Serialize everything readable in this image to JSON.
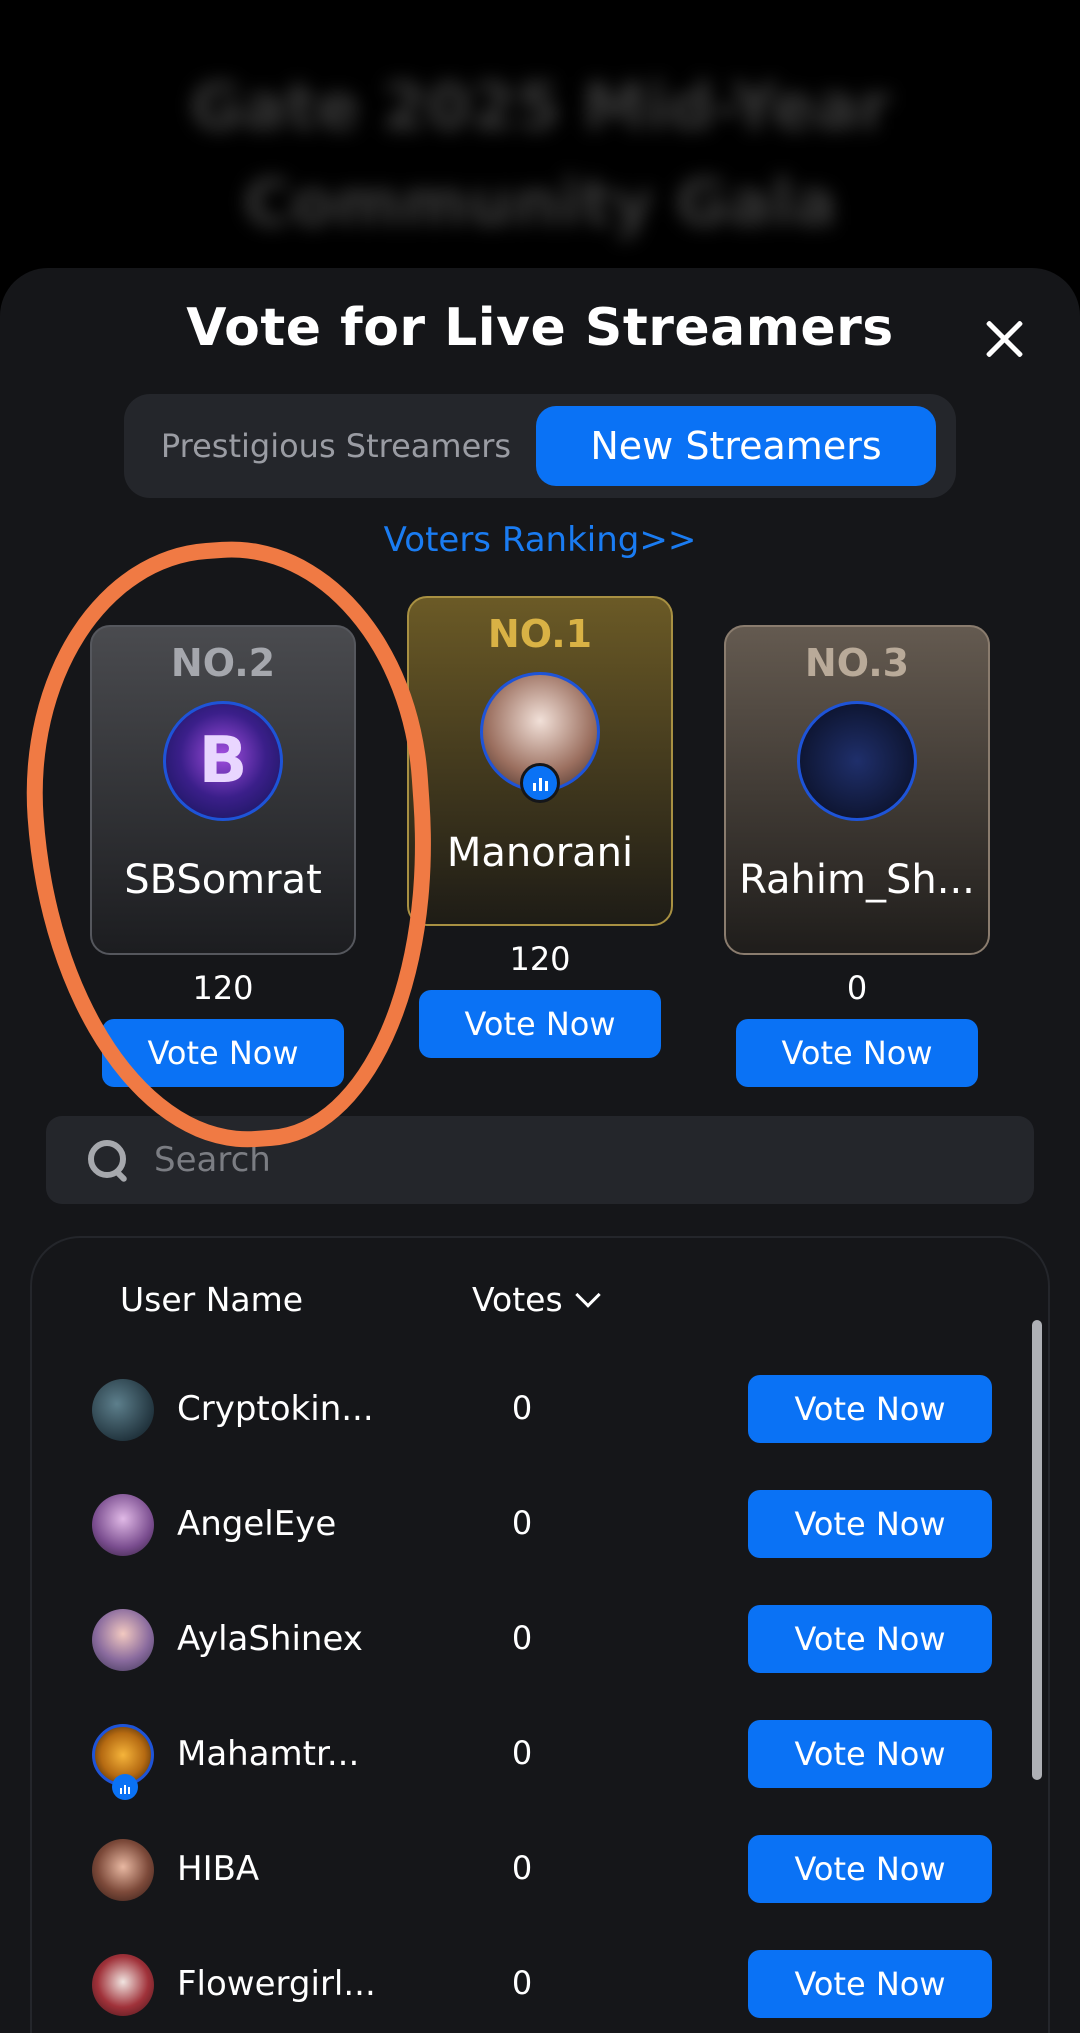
{
  "background": {
    "title": "Gate 2025 Mid-Year Community Gala"
  },
  "sheet": {
    "title": "Vote for Live Streamers",
    "tabs": [
      {
        "label": "Prestigious Streamers",
        "active": false
      },
      {
        "label": "New Streamers",
        "active": true
      }
    ],
    "voters_ranking": "Voters Ranking>>"
  },
  "podium": [
    {
      "rank": "NO.2",
      "name": "SBSomrat",
      "votes": "120",
      "button": "Vote Now",
      "avatar_text": "B"
    },
    {
      "rank": "NO.1",
      "name": "Manorani",
      "votes": "120",
      "button": "Vote Now",
      "live": true
    },
    {
      "rank": "NO.3",
      "name": "Rahim_Sh...",
      "votes": "0",
      "button": "Vote Now"
    }
  ],
  "search": {
    "placeholder": "Search"
  },
  "table": {
    "header_name": "User Name",
    "header_votes": "Votes",
    "rows": [
      {
        "name": "Cryptokin...",
        "votes": "0",
        "button": "Vote Now"
      },
      {
        "name": "AngelEye",
        "votes": "0",
        "button": "Vote Now"
      },
      {
        "name": "AylaShinex",
        "votes": "0",
        "button": "Vote Now"
      },
      {
        "name": "Mahamtr...",
        "votes": "0",
        "button": "Vote Now",
        "live": true
      },
      {
        "name": "HIBA",
        "votes": "0",
        "button": "Vote Now"
      },
      {
        "name": "Flowergirl...",
        "votes": "0",
        "button": "Vote Now"
      }
    ]
  },
  "colors": {
    "accent": "#0a72f5",
    "annotation": "#f07a44",
    "gold": "#d9b245"
  }
}
